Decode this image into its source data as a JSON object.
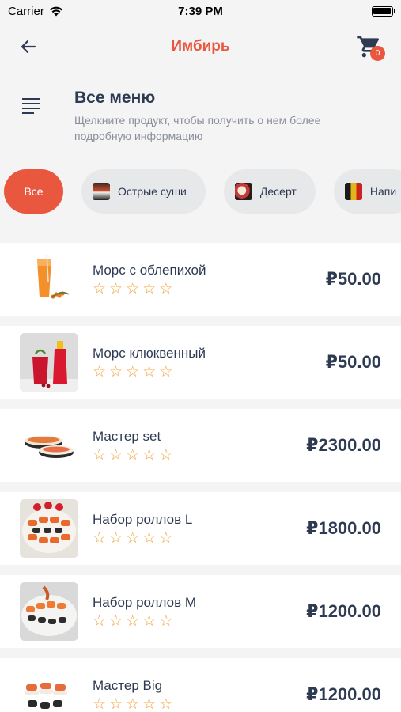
{
  "status": {
    "carrier": "Carrier",
    "time": "7:39 PM"
  },
  "nav": {
    "title": "Имбирь",
    "cart_count": "0"
  },
  "menu": {
    "title": "Все меню",
    "subtitle": "Щелкните продукт, чтобы получить о нем более подробную информацию"
  },
  "categories": [
    {
      "label": "Все",
      "active": true
    },
    {
      "label": "Острые суши"
    },
    {
      "label": "Десерт"
    },
    {
      "label": "Напи"
    }
  ],
  "products": [
    {
      "name": "Морс с облепихой",
      "price": "₽50.00",
      "rating": 0,
      "rating_max": 5
    },
    {
      "name": "Морс клюквенный",
      "price": "₽50.00",
      "rating": 0,
      "rating_max": 5
    },
    {
      "name": "Мастер set",
      "price": "₽2300.00",
      "rating": 0,
      "rating_max": 5
    },
    {
      "name": "Набор роллов L",
      "price": "₽1800.00",
      "rating": 0,
      "rating_max": 5
    },
    {
      "name": "Набор роллов M",
      "price": "₽1200.00",
      "rating": 0,
      "rating_max": 5
    },
    {
      "name": "Мастер Big",
      "price": "₽1200.00",
      "rating": 0,
      "rating_max": 5
    }
  ],
  "colors": {
    "accent": "#e9573f",
    "text": "#2d3a52",
    "star": "#f3a63b",
    "background": "#f4f4f5"
  }
}
